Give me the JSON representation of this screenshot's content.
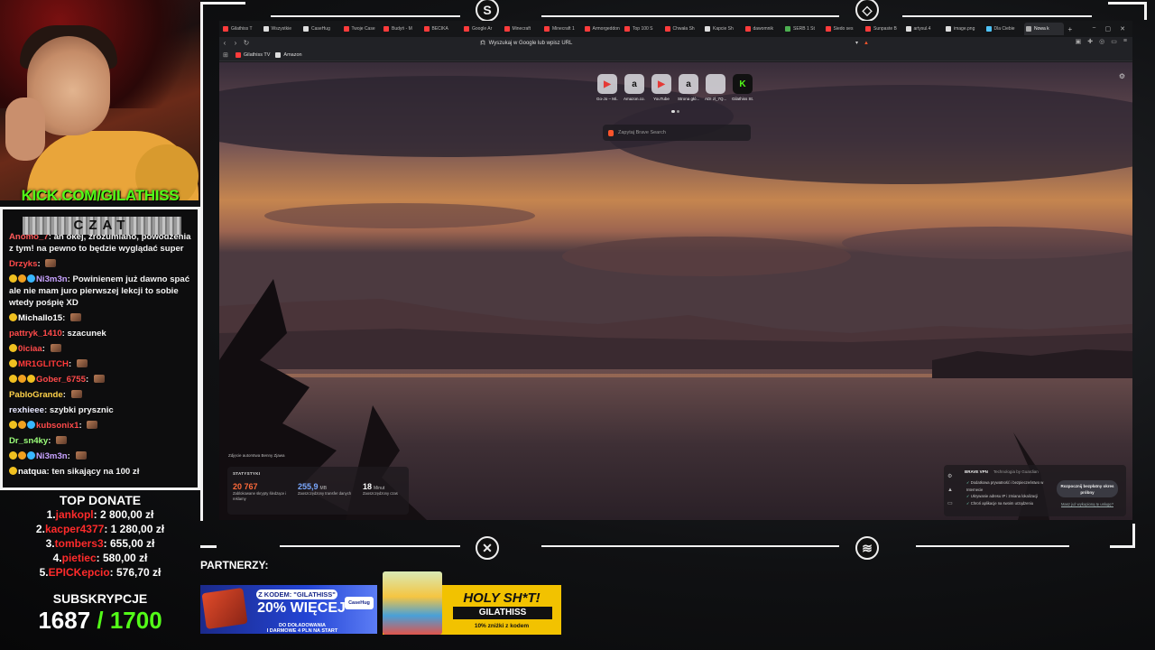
{
  "overlay": {
    "kick_url": "KICK.COM/GILATHISS",
    "chat_title": "CZAT",
    "top_donate_title": "TOP DONATE",
    "subs_title": "SUBSKRYPCJE",
    "subs_current": "1687",
    "subs_goal": "/ 1700",
    "partners_label": "PARTNERZY:",
    "accent_green": "#53fc18",
    "donate_name_color": "#ff2b2b"
  },
  "chat": [
    {
      "user": "Anomo_7",
      "user_color": "#ff5a5a",
      "text": "ah okej, zrozumiano, powodzenia z tym! na pewno to będzie wyglądać super",
      "badges": []
    },
    {
      "user": "Drzyks",
      "user_color": "#ff4a4a",
      "text": "",
      "badges": [],
      "emote": true
    },
    {
      "user": "Ni3m3n",
      "user_color": "#c7a2ff",
      "text": "Powinienem już dawno spać ale nie mam juro pierwszej lekcji to sobie wtedy pośpię XD",
      "badges": [
        "#f0c020",
        "#f0a020",
        "#38b6ff"
      ]
    },
    {
      "user": "Michallo15",
      "user_color": "#ffffff",
      "text": "",
      "badges": [
        "#f0c020"
      ],
      "emote": true
    },
    {
      "user": "pattryk_1410",
      "user_color": "#ff4a4a",
      "text": "szacunek",
      "badges": []
    },
    {
      "user": "0iciaa",
      "user_color": "#ff4a4a",
      "text": "",
      "badges": [
        "#f0c020"
      ],
      "emote": true
    },
    {
      "user": "MR1GLITCH",
      "user_color": "#ff3a3a",
      "text": "",
      "badges": [
        "#f0c020"
      ],
      "emote": true
    },
    {
      "user": "Gober_6755",
      "user_color": "#ff4a4a",
      "text": "",
      "badges": [
        "#f0c020",
        "#f0a020",
        "#f0c020"
      ],
      "emote": true
    },
    {
      "user": "PabloGrande",
      "user_color": "#ffd24a",
      "text": "",
      "badges": [],
      "emote": true
    },
    {
      "user": "rexhieee",
      "user_color": "#e7e7ff",
      "text": "szybki prysznic",
      "badges": []
    },
    {
      "user": "kubsonix1",
      "user_color": "#ff4a4a",
      "text": "",
      "badges": [
        "#f0c020",
        "#f0a020",
        "#38b6ff"
      ],
      "emote": true
    },
    {
      "user": "Dr_sn4ky",
      "user_color": "#9cff7a",
      "text": "",
      "badges": [],
      "emote": true
    },
    {
      "user": "Ni3m3n",
      "user_color": "#c7a2ff",
      "text": "",
      "badges": [
        "#f0c020",
        "#f0a020",
        "#38b6ff"
      ],
      "emote": true
    },
    {
      "user": "natqua",
      "user_color": "#ffffff",
      "text": "ten sikający na 100 zł",
      "badges": [
        "#f0c020"
      ]
    }
  ],
  "donates": [
    {
      "rank": "1.",
      "name": "jankopl",
      "amount": "2 800,00 zł"
    },
    {
      "rank": "2.",
      "name": "kacper4377",
      "amount": "1 280,00 zł"
    },
    {
      "rank": "3.",
      "name": "tombers3",
      "amount": "655,00 zł"
    },
    {
      "rank": "4.",
      "name": "pietiec",
      "amount": "580,00 zł"
    },
    {
      "rank": "5.",
      "name": "EPICKepcio",
      "amount": "576,70 zł"
    }
  ],
  "browser": {
    "tabs": [
      {
        "label": "Gilathiss T",
        "color": "#ff3b3b"
      },
      {
        "label": "Wszystkie",
        "color": "#dddddd"
      },
      {
        "label": "CaseHug",
        "color": "#dddddd"
      },
      {
        "label": "Twoje Case",
        "color": "#ff3b3b"
      },
      {
        "label": "Budyń - M",
        "color": "#ff3b3b"
      },
      {
        "label": "BECIKA",
        "color": "#ff3b3b"
      },
      {
        "label": "Google Ar",
        "color": "#ff3b3b"
      },
      {
        "label": "Minecraft",
        "color": "#ff3b3b"
      },
      {
        "label": "Minecraft 1",
        "color": "#ff3b3b"
      },
      {
        "label": "Armorgeddon",
        "color": "#ff3b3b"
      },
      {
        "label": "Top 100 S",
        "color": "#ff3b3b"
      },
      {
        "label": "Chwała Sh",
        "color": "#ff3b3b"
      },
      {
        "label": "Kapcie Sh",
        "color": "#dddddd"
      },
      {
        "label": "dawomnik",
        "color": "#ff3b3b"
      },
      {
        "label": "SERB 1 St",
        "color": "#4caf50"
      },
      {
        "label": "Siedo ses",
        "color": "#ff3b3b"
      },
      {
        "label": "Sunpaste B",
        "color": "#ff3b3b"
      },
      {
        "label": "artysul.4",
        "color": "#dddddd"
      },
      {
        "label": "image.png",
        "color": "#dddddd"
      },
      {
        "label": "Dla Ciebie",
        "color": "#4fc3f7"
      },
      {
        "label": "Nowa k",
        "color": "#aaaaaa",
        "active": true
      }
    ],
    "new_tab_plus": "+",
    "address_text": "Wyszukaj w Google lub wpisz URL",
    "bookmarks": [
      {
        "label": "Gilathiss TV",
        "color": "#ff3b3b"
      },
      {
        "label": "Amazon",
        "color": "#dddddd"
      }
    ],
    "top_sites": [
      {
        "label": "Go-Jo – Mi...",
        "icon": "▶",
        "color": "#e53935"
      },
      {
        "label": "Amazon.co...",
        "icon": "a",
        "color": "#111111"
      },
      {
        "label": "YouTube",
        "icon": "▶",
        "color": "#e53935"
      },
      {
        "label": "Strona głó...",
        "icon": "a",
        "color": "#111111"
      },
      {
        "label": "ADI zl_7Q...",
        "icon": "",
        "color": "#111111"
      },
      {
        "label": "Gilathiss St...",
        "icon": "K",
        "color": "#53fc18"
      }
    ],
    "search_placeholder": "Zapytaj Brave Search",
    "photo_credit": "Zdjęcie autorstwa Benny Zjawa",
    "stats": {
      "title": "STATYSTYKI",
      "items": [
        {
          "num": "20 767",
          "unit": "",
          "desc": "Zablokowane skrypty śledzące i reklamy",
          "color": "#ff6a3a"
        },
        {
          "num": "255,9",
          "unit": "MB",
          "desc": "Zaoszczędzony transfer danych",
          "color": "#7aa8ff"
        },
        {
          "num": "18",
          "unit": "Minut",
          "desc": "Zaoszczędzony czas",
          "color": "#ffffff"
        }
      ]
    },
    "vpn": {
      "title": "BRAVE VPN",
      "powered": "Technologia by Guardian",
      "features": [
        "Dodatkowa prywatność i bezpieczeństwo w Internecie",
        "Ukrywanie adresu IP i zmiana lokalizacji",
        "Chroń aplikacje na swoim urządzeniu"
      ],
      "cta": "Rozpocznij bezpłatny okres próbny",
      "link": "Masz już wykupioną tę usługę?"
    }
  },
  "partners": {
    "casehug": {
      "code": "Z KODEM: \"GILATHISS\"",
      "headline": "20% WIĘCEJ",
      "sub1": "DO DOŁADOWANIA",
      "sub2": "I DARMOWE 4 PLN NA START",
      "logo": "CaseHug"
    },
    "holy": {
      "title": "HOLY SH*T!",
      "code": "GILATHISS",
      "discount": "10% zniżki z kodem"
    }
  }
}
